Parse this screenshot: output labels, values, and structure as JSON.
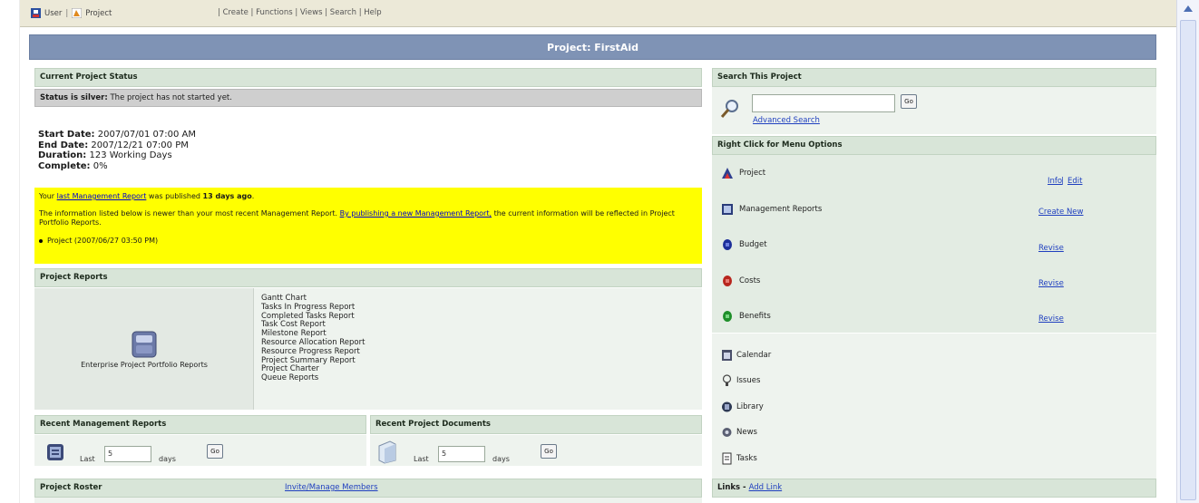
{
  "topbar": {
    "user_label": "User",
    "project_label": "Project",
    "menu": "| Create | Functions | Views | Search | Help"
  },
  "page_title": "Project: FirstAid",
  "status": {
    "header": "Current Project Status",
    "status_bold": "Status is silver:",
    "status_text": "The project has not started yet.",
    "start_label": "Start Date:",
    "start_value": "2007/07/01 07:00 AM",
    "end_label": "End Date:",
    "end_value": "2007/12/21 07:00 PM",
    "duration_label": "Duration:",
    "duration_value": "123 Working Days",
    "complete_label": "Complete:",
    "complete_value": "0%"
  },
  "notice": {
    "p1_pre": "Your",
    "p1_link": "last Management Report",
    "p1_mid": "was published",
    "p1_bold": "13 days ago",
    "p1_end": ".",
    "p2_pre": "The information listed below is newer than your most recent Management Report.",
    "p2_link": "By publishing a new Management Report,",
    "p2_post": "the current information will be reflected in Project Portfolio Reports.",
    "bullet": "Project (2007/06/27 03:50 PM)"
  },
  "reports": {
    "header": "Project Reports",
    "enterprise_label": "Enterprise Project Portfolio Reports",
    "items": [
      "Gantt Chart",
      "Tasks In Progress Report",
      "Completed Tasks Report",
      "Task Cost Report",
      "Milestone Report",
      "Resource Allocation Report",
      "Resource Progress Report",
      "Project Summary Report",
      "Project Charter",
      "Queue Reports"
    ]
  },
  "recent_mgmt": {
    "header": "Recent Management Reports",
    "last_label": "Last",
    "days_value": "5",
    "days_label": "days",
    "go": "Go"
  },
  "recent_docs": {
    "header": "Recent Project Documents",
    "last_label": "Last",
    "days_value": "5",
    "days_label": "days",
    "go": "Go"
  },
  "roster": {
    "header": "Project Roster",
    "link": "Invite/Manage Members"
  },
  "search": {
    "header": "Search This Project",
    "go": "Go",
    "advanced": "Advanced Search"
  },
  "menu_options": {
    "header": "Right Click for Menu Options",
    "project": "Project",
    "info_link": "Info",
    "edit_link": "Edit",
    "mgmt_reports": "Management Reports",
    "create_new": "Create New",
    "budget": "Budget",
    "costs": "Costs",
    "benefits": "Benefits",
    "revise": "Revise"
  },
  "tools": {
    "calendar": "Calendar",
    "issues": "Issues",
    "library": "Library",
    "news": "News",
    "tasks": "Tasks"
  },
  "links": {
    "label": "Links -",
    "add": "Add Link"
  }
}
